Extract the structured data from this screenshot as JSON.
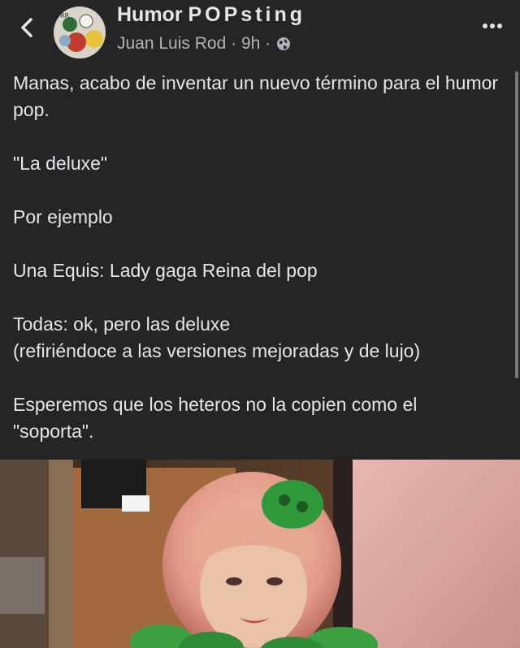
{
  "header": {
    "group_name_part1": "Humor ",
    "group_name_part2": "POPsting",
    "author": "Juan Luis Rod",
    "separator": " · ",
    "time": "9h",
    "separator2": " ·",
    "avatar_text": "RR"
  },
  "post": {
    "paragraphs": [
      "Manas, acabo de inventar un nuevo término para el humor pop.",
      "\"La deluxe\"",
      "Por ejemplo",
      "Una Equis: Lady gaga Reina del pop",
      "Todas: ok, pero las deluxe\n(refiriéndoce a las versiones mejoradas y de lujo)",
      "Esperemos que los heteros no la copien como el \"soporta\"."
    ]
  },
  "colors": {
    "background": "#242526",
    "text_primary": "#e4e6eb",
    "text_secondary": "#b0b3b8"
  },
  "icons": {
    "back": "chevron-left-icon",
    "more": "more-horizontal-icon",
    "privacy": "globe-icon"
  }
}
